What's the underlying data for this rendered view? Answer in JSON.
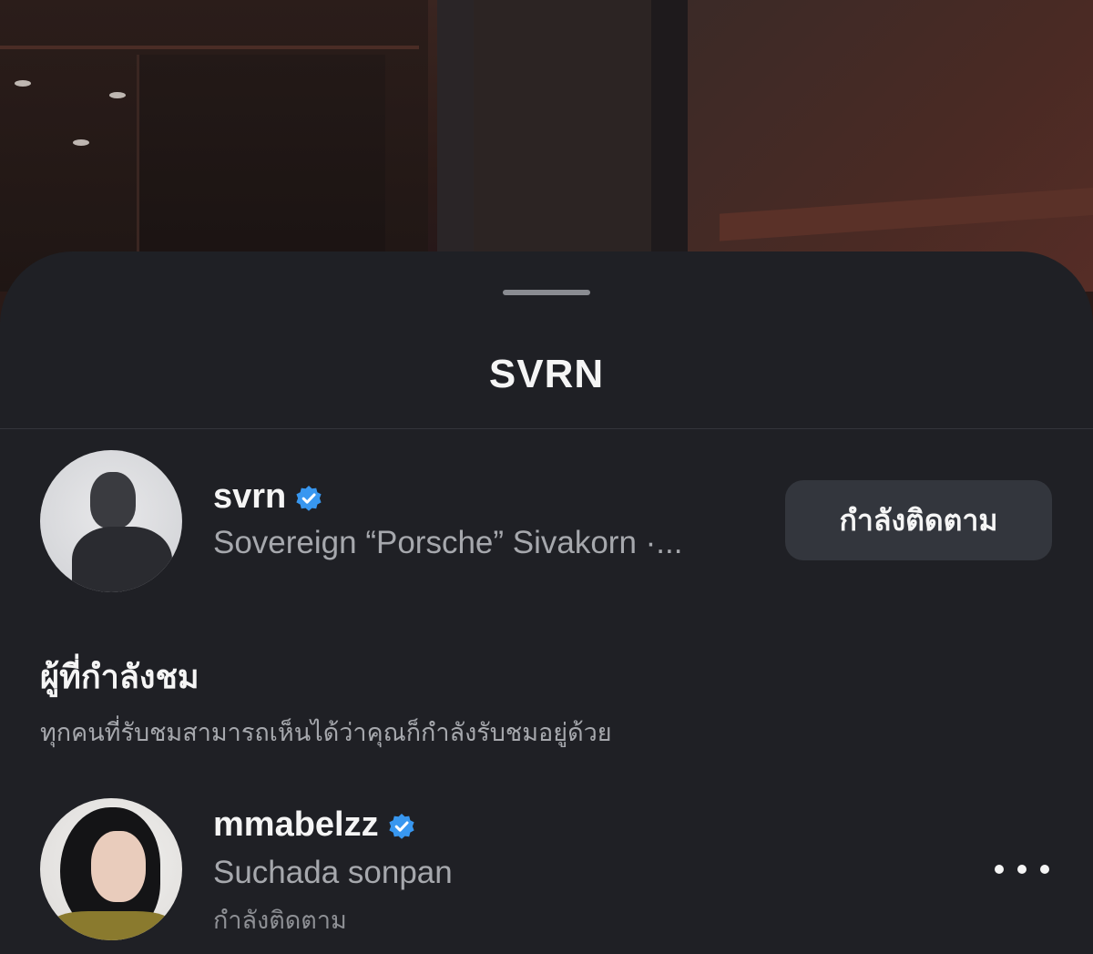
{
  "sheet": {
    "title": "SVRN"
  },
  "host": {
    "username": "svrn",
    "full_name": "Sovereign “Porsche” Sivakorn ·...",
    "verified": true,
    "follow_button_label": "กำลังติดตาม"
  },
  "viewers": {
    "heading": "ผู้ที่กำลังชม",
    "subtext": "ทุกคนที่รับชมสามารถเห็นได้ว่าคุณก็กำลังรับชมอยู่ด้วย",
    "items": [
      {
        "username": "mmabelzz",
        "full_name": "Suchada sonpan",
        "status": "กำลังติดตาม",
        "verified": true
      }
    ]
  },
  "icons": {
    "verified": "verified-badge-icon",
    "more": "more-options-icon"
  },
  "colors": {
    "sheet_background": "#1f2025",
    "verified_blue": "#3897f0",
    "secondary_text": "#a6a8ad",
    "button_background": "#33363d"
  }
}
